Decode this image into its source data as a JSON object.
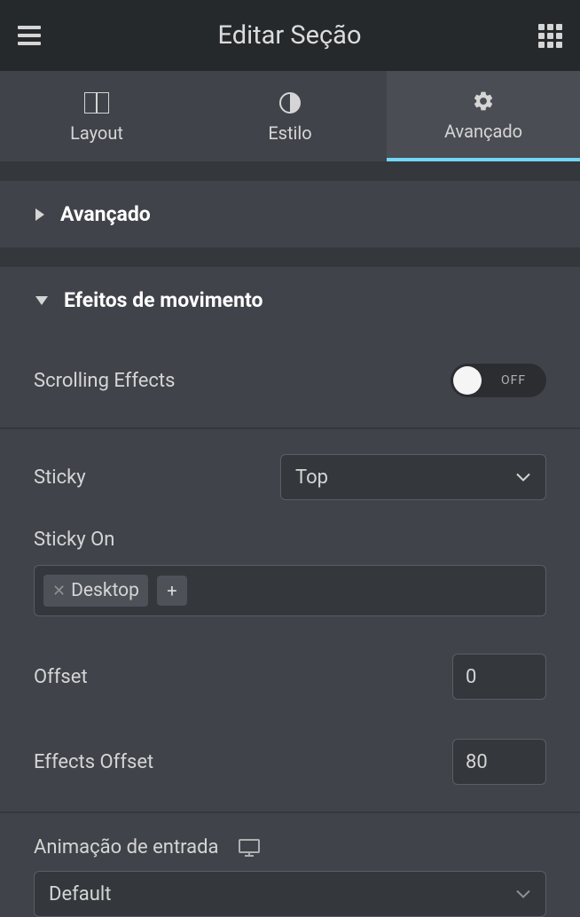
{
  "header": {
    "title": "Editar Seção"
  },
  "tabs": {
    "layout": "Layout",
    "style": "Estilo",
    "advanced": "Avançado"
  },
  "sections": {
    "advanced": "Avançado",
    "motion": "Efeitos de movimento"
  },
  "controls": {
    "scrolling_effects": {
      "label": "Scrolling Effects",
      "state": "OFF"
    },
    "sticky": {
      "label": "Sticky",
      "value": "Top"
    },
    "sticky_on": {
      "label": "Sticky On",
      "tags": [
        "Desktop"
      ]
    },
    "offset": {
      "label": "Offset",
      "value": "0"
    },
    "effects_offset": {
      "label": "Effects Offset",
      "value": "80"
    },
    "entrance_animation": {
      "label": "Animação de entrada",
      "value": "Default"
    }
  }
}
